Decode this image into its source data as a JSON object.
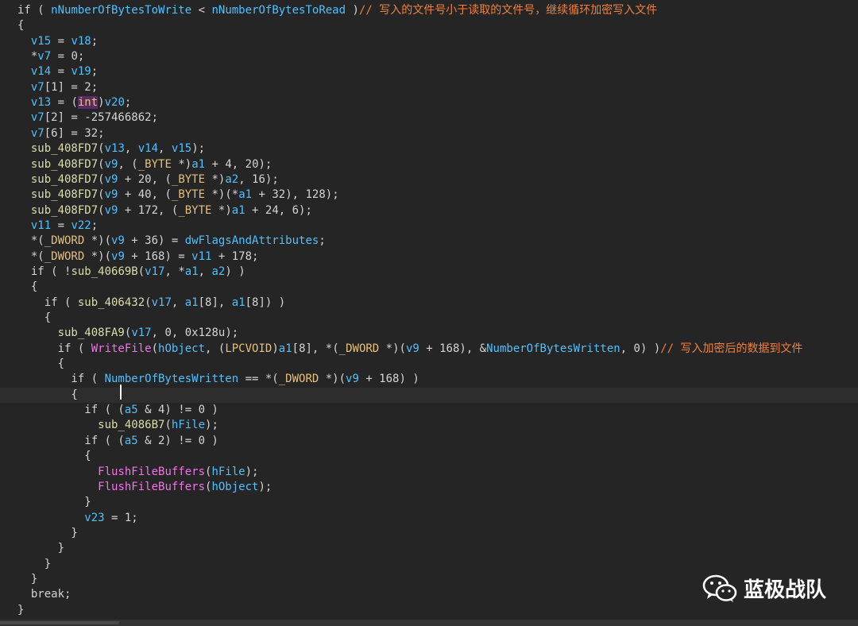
{
  "code": {
    "lines": [
      [
        [
          "k",
          "if ( "
        ],
        [
          "g",
          "nNumberOfBytesToWrite"
        ],
        [
          "p",
          " < "
        ],
        [
          "g",
          "nNumberOfBytesToRead"
        ],
        [
          "p",
          " )"
        ],
        [
          "c",
          "// 写入的文件号小于读取的文件号，继续循环加密写入文件"
        ]
      ],
      [
        [
          "p",
          "{"
        ]
      ],
      [
        [
          "p",
          "  "
        ],
        [
          "v",
          "v15"
        ],
        [
          "p",
          " = "
        ],
        [
          "v",
          "v18"
        ],
        [
          "p",
          ";"
        ]
      ],
      [
        [
          "p",
          "  *"
        ],
        [
          "v",
          "v7"
        ],
        [
          "p",
          " = 0;"
        ]
      ],
      [
        [
          "p",
          "  "
        ],
        [
          "v",
          "v14"
        ],
        [
          "p",
          " = "
        ],
        [
          "v",
          "v19"
        ],
        [
          "p",
          ";"
        ]
      ],
      [
        [
          "p",
          "  "
        ],
        [
          "v",
          "v7"
        ],
        [
          "p",
          "[1] = 2;"
        ]
      ],
      [
        [
          "p",
          "  "
        ],
        [
          "v",
          "v13"
        ],
        [
          "p",
          " = ("
        ],
        [
          "kwhi",
          "int"
        ],
        [
          "p",
          ")"
        ],
        [
          "v",
          "v20"
        ],
        [
          "p",
          ";"
        ]
      ],
      [
        [
          "p",
          "  "
        ],
        [
          "v",
          "v7"
        ],
        [
          "p",
          "[2] = -257466862;"
        ]
      ],
      [
        [
          "p",
          "  "
        ],
        [
          "v",
          "v7"
        ],
        [
          "p",
          "[6] = 32;"
        ]
      ],
      [
        [
          "p",
          "  "
        ],
        [
          "f",
          "sub_408FD7"
        ],
        [
          "p",
          "("
        ],
        [
          "v",
          "v13"
        ],
        [
          "p",
          ", "
        ],
        [
          "v",
          "v14"
        ],
        [
          "p",
          ", "
        ],
        [
          "v",
          "v15"
        ],
        [
          "p",
          ");"
        ]
      ],
      [
        [
          "p",
          "  "
        ],
        [
          "f",
          "sub_408FD7"
        ],
        [
          "p",
          "("
        ],
        [
          "v",
          "v9"
        ],
        [
          "p",
          ", ("
        ],
        [
          "t",
          "_BYTE"
        ],
        [
          "p",
          " *)"
        ],
        [
          "v",
          "a1"
        ],
        [
          "p",
          " + 4, 20);"
        ]
      ],
      [
        [
          "p",
          "  "
        ],
        [
          "f",
          "sub_408FD7"
        ],
        [
          "p",
          "("
        ],
        [
          "v",
          "v9"
        ],
        [
          "p",
          " + 20, ("
        ],
        [
          "t",
          "_BYTE"
        ],
        [
          "p",
          " *)"
        ],
        [
          "v",
          "a2"
        ],
        [
          "p",
          ", 16);"
        ]
      ],
      [
        [
          "p",
          "  "
        ],
        [
          "f",
          "sub_408FD7"
        ],
        [
          "p",
          "("
        ],
        [
          "v",
          "v9"
        ],
        [
          "p",
          " + 40, ("
        ],
        [
          "t",
          "_BYTE"
        ],
        [
          "p",
          " *)(*"
        ],
        [
          "v",
          "a1"
        ],
        [
          "p",
          " + 32), 128);"
        ]
      ],
      [
        [
          "p",
          "  "
        ],
        [
          "f",
          "sub_408FD7"
        ],
        [
          "p",
          "("
        ],
        [
          "v",
          "v9"
        ],
        [
          "p",
          " + 172, ("
        ],
        [
          "t",
          "_BYTE"
        ],
        [
          "p",
          " *)"
        ],
        [
          "v",
          "a1"
        ],
        [
          "p",
          " + 24, 6);"
        ]
      ],
      [
        [
          "p",
          "  "
        ],
        [
          "v",
          "v11"
        ],
        [
          "p",
          " = "
        ],
        [
          "v",
          "v22"
        ],
        [
          "p",
          ";"
        ]
      ],
      [
        [
          "p",
          "  *("
        ],
        [
          "t",
          "_DWORD"
        ],
        [
          "p",
          " *)("
        ],
        [
          "v",
          "v9"
        ],
        [
          "p",
          " + 36) = "
        ],
        [
          "g",
          "dwFlagsAndAttributes"
        ],
        [
          "p",
          ";"
        ]
      ],
      [
        [
          "p",
          "  *("
        ],
        [
          "t",
          "_DWORD"
        ],
        [
          "p",
          " *)("
        ],
        [
          "v",
          "v9"
        ],
        [
          "p",
          " + 168) = "
        ],
        [
          "v",
          "v11"
        ],
        [
          "p",
          " + 178;"
        ]
      ],
      [
        [
          "p",
          "  if ( !"
        ],
        [
          "f",
          "sub_40669B"
        ],
        [
          "p",
          "("
        ],
        [
          "v",
          "v17"
        ],
        [
          "p",
          ", *"
        ],
        [
          "v",
          "a1"
        ],
        [
          "p",
          ", "
        ],
        [
          "v",
          "a2"
        ],
        [
          "p",
          ") )"
        ]
      ],
      [
        [
          "p",
          "  {"
        ]
      ],
      [
        [
          "p",
          "    if ( "
        ],
        [
          "f",
          "sub_406432"
        ],
        [
          "p",
          "("
        ],
        [
          "v",
          "v17"
        ],
        [
          "p",
          ", "
        ],
        [
          "v",
          "a1"
        ],
        [
          "p",
          "[8], "
        ],
        [
          "v",
          "a1"
        ],
        [
          "p",
          "[8]) )"
        ]
      ],
      [
        [
          "p",
          "    {"
        ]
      ],
      [
        [
          "p",
          "      "
        ],
        [
          "f",
          "sub_408FA9"
        ],
        [
          "p",
          "("
        ],
        [
          "v",
          "v17"
        ],
        [
          "p",
          ", 0, 0x128u);"
        ]
      ],
      [
        [
          "p",
          "      if ( "
        ],
        [
          "a",
          "WriteFile"
        ],
        [
          "p",
          "("
        ],
        [
          "v",
          "hObject"
        ],
        [
          "p",
          ", ("
        ],
        [
          "t",
          "LPCVOID"
        ],
        [
          "p",
          ")"
        ],
        [
          "v",
          "a1"
        ],
        [
          "p",
          "[8], *("
        ],
        [
          "t",
          "_DWORD"
        ],
        [
          "p",
          " *)("
        ],
        [
          "v",
          "v9"
        ],
        [
          "p",
          " + 168), &"
        ],
        [
          "g",
          "NumberOfBytesWritten"
        ],
        [
          "p",
          ", 0) )"
        ],
        [
          "c",
          "// 写入加密后的数据到文件"
        ]
      ],
      [
        [
          "p",
          "      {"
        ]
      ],
      [
        [
          "p",
          "        if ( "
        ],
        [
          "g",
          "NumberOfBytesWritten"
        ],
        [
          "p",
          " == *("
        ],
        [
          "t",
          "_DWORD"
        ],
        [
          "p",
          " *)("
        ],
        [
          "v",
          "v9"
        ],
        [
          "p",
          " + 168) )"
        ]
      ],
      [
        [
          "p",
          "        {"
        ]
      ],
      [
        [
          "p",
          "          if ( ("
        ],
        [
          "v",
          "a5"
        ],
        [
          "p",
          " & 4) != 0 )"
        ]
      ],
      [
        [
          "p",
          "            "
        ],
        [
          "f",
          "sub_4086B7"
        ],
        [
          "p",
          "("
        ],
        [
          "v",
          "hFile"
        ],
        [
          "p",
          ");"
        ]
      ],
      [
        [
          "p",
          "          if ( ("
        ],
        [
          "v",
          "a5"
        ],
        [
          "p",
          " & 2) != 0 )"
        ]
      ],
      [
        [
          "p",
          "          {"
        ]
      ],
      [
        [
          "p",
          "            "
        ],
        [
          "a",
          "FlushFileBuffers"
        ],
        [
          "p",
          "("
        ],
        [
          "v",
          "hFile"
        ],
        [
          "p",
          ");"
        ]
      ],
      [
        [
          "p",
          "            "
        ],
        [
          "a",
          "FlushFileBuffers"
        ],
        [
          "p",
          "("
        ],
        [
          "v",
          "hObject"
        ],
        [
          "p",
          ");"
        ]
      ],
      [
        [
          "p",
          "          }"
        ]
      ],
      [
        [
          "p",
          "          "
        ],
        [
          "v",
          "v23"
        ],
        [
          "p",
          " = 1;"
        ]
      ],
      [
        [
          "p",
          "        }"
        ]
      ],
      [
        [
          "p",
          "      }"
        ]
      ],
      [
        [
          "p",
          "    }"
        ]
      ],
      [
        [
          "p",
          "  }"
        ]
      ],
      [
        [
          "p",
          "  break;"
        ]
      ],
      [
        [
          "p",
          "}"
        ]
      ]
    ],
    "current_line_index": 25
  },
  "watermark": {
    "text": "蓝极战队",
    "icon": "wechat-icon"
  },
  "colors": {
    "background": "#252526",
    "variable": "#4fc1ff",
    "function": "#dcdcaa",
    "type": "#e5c07b",
    "api": "#f472e8",
    "comment": "#f0803c"
  }
}
